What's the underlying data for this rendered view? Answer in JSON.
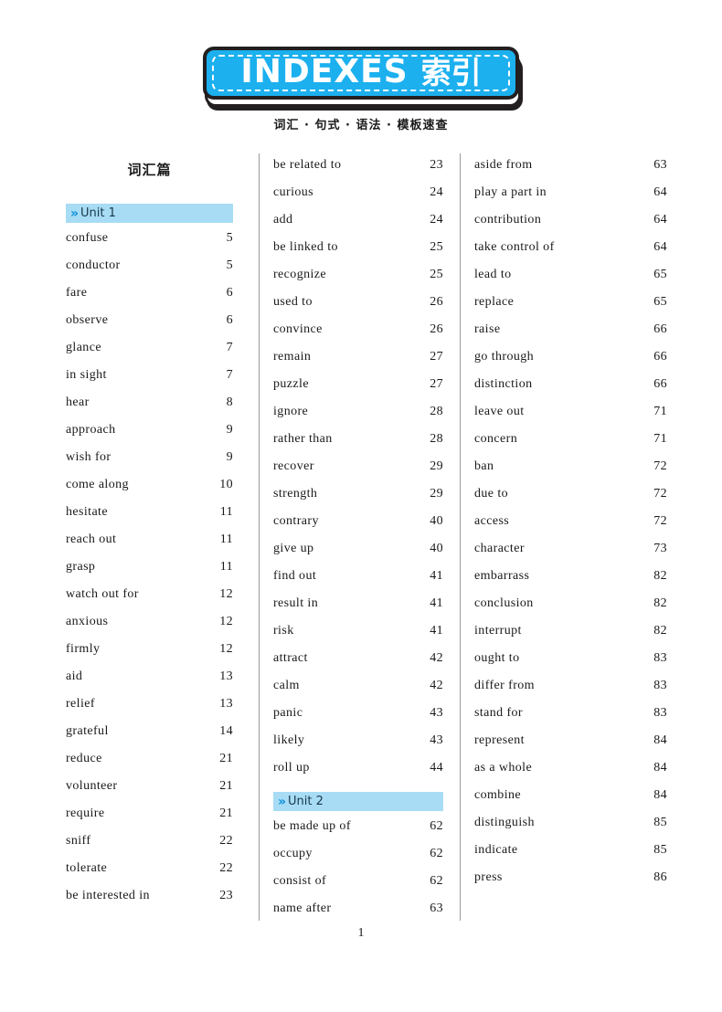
{
  "header": {
    "title_en": "INDEXES",
    "title_cn": "索引",
    "subtitle": "词汇 · 句式 · 语法 · 模板速查"
  },
  "section": {
    "title": "词汇篇"
  },
  "units": {
    "unit1": {
      "chevron": "»",
      "label": "Unit 1"
    },
    "unit2": {
      "chevron": "»",
      "label": "Unit 2"
    }
  },
  "columns": [
    {
      "entries": [
        {
          "term": "confuse",
          "page": "5"
        },
        {
          "term": "conductor",
          "page": "5"
        },
        {
          "term": "fare",
          "page": "6"
        },
        {
          "term": "observe",
          "page": "6"
        },
        {
          "term": "glance",
          "page": "7"
        },
        {
          "term": "in sight",
          "page": "7"
        },
        {
          "term": "hear",
          "page": "8"
        },
        {
          "term": "approach",
          "page": "9"
        },
        {
          "term": "wish for",
          "page": "9"
        },
        {
          "term": "come along",
          "page": "10"
        },
        {
          "term": "hesitate",
          "page": "11"
        },
        {
          "term": "reach out",
          "page": "11"
        },
        {
          "term": "grasp",
          "page": "11"
        },
        {
          "term": "watch out for",
          "page": "12"
        },
        {
          "term": "anxious",
          "page": "12"
        },
        {
          "term": "firmly",
          "page": "12"
        },
        {
          "term": "aid",
          "page": "13"
        },
        {
          "term": "relief",
          "page": "13"
        },
        {
          "term": "grateful",
          "page": "14"
        },
        {
          "term": "reduce",
          "page": "21"
        },
        {
          "term": "volunteer",
          "page": "21"
        },
        {
          "term": "require",
          "page": "21"
        },
        {
          "term": "sniff",
          "page": "22"
        },
        {
          "term": "tolerate",
          "page": "22"
        },
        {
          "term": "be interested in",
          "page": "23"
        }
      ]
    },
    {
      "entries_top": [
        {
          "term": "be related to",
          "page": "23"
        },
        {
          "term": "curious",
          "page": "24"
        },
        {
          "term": "add",
          "page": "24"
        },
        {
          "term": "be linked to",
          "page": "25"
        },
        {
          "term": "recognize",
          "page": "25"
        },
        {
          "term": "used to",
          "page": "26"
        },
        {
          "term": "convince",
          "page": "26"
        },
        {
          "term": "remain",
          "page": "27"
        },
        {
          "term": "puzzle",
          "page": "27"
        },
        {
          "term": "ignore",
          "page": "28"
        },
        {
          "term": "rather than",
          "page": "28"
        },
        {
          "term": "recover",
          "page": "29"
        },
        {
          "term": "strength",
          "page": "29"
        },
        {
          "term": "contrary",
          "page": "40"
        },
        {
          "term": "give up",
          "page": "40"
        },
        {
          "term": "find out",
          "page": "41"
        },
        {
          "term": "result in",
          "page": "41"
        },
        {
          "term": "risk",
          "page": "41"
        },
        {
          "term": "attract",
          "page": "42"
        },
        {
          "term": "calm",
          "page": "42"
        },
        {
          "term": "panic",
          "page": "43"
        },
        {
          "term": "likely",
          "page": "43"
        },
        {
          "term": "roll up",
          "page": "44"
        }
      ],
      "entries_bottom": [
        {
          "term": "be made up of",
          "page": "62"
        },
        {
          "term": "occupy",
          "page": "62"
        },
        {
          "term": "consist of",
          "page": "62"
        },
        {
          "term": "name after",
          "page": "63"
        }
      ]
    },
    {
      "entries": [
        {
          "term": "aside from",
          "page": "63"
        },
        {
          "term": "play a part in",
          "page": "64"
        },
        {
          "term": "contribution",
          "page": "64"
        },
        {
          "term": "take control of",
          "page": "64"
        },
        {
          "term": "lead to",
          "page": "65"
        },
        {
          "term": "replace",
          "page": "65"
        },
        {
          "term": "raise",
          "page": "66"
        },
        {
          "term": "go through",
          "page": "66"
        },
        {
          "term": "distinction",
          "page": "66"
        },
        {
          "term": "leave out",
          "page": "71"
        },
        {
          "term": "concern",
          "page": "71"
        },
        {
          "term": "ban",
          "page": "72"
        },
        {
          "term": "due to",
          "page": "72"
        },
        {
          "term": "access",
          "page": "72"
        },
        {
          "term": "character",
          "page": "73"
        },
        {
          "term": "embarrass",
          "page": "82"
        },
        {
          "term": "conclusion",
          "page": "82"
        },
        {
          "term": "interrupt",
          "page": "82"
        },
        {
          "term": "ought to",
          "page": "83"
        },
        {
          "term": "differ from",
          "page": "83"
        },
        {
          "term": "stand for",
          "page": "83"
        },
        {
          "term": "represent",
          "page": "84"
        },
        {
          "term": "as a whole",
          "page": "84"
        },
        {
          "term": "combine",
          "page": "84"
        },
        {
          "term": "distinguish",
          "page": "85"
        },
        {
          "term": "indicate",
          "page": "85"
        },
        {
          "term": "press",
          "page": "86"
        }
      ]
    }
  ],
  "footer": {
    "page_number": "1"
  },
  "colors": {
    "banner_fill": "#1cb0ef",
    "banner_border": "#231f20",
    "unit_bar": "#a8dcf5",
    "chevron": "#0f8fd8",
    "divider": "#9a9a9a"
  }
}
